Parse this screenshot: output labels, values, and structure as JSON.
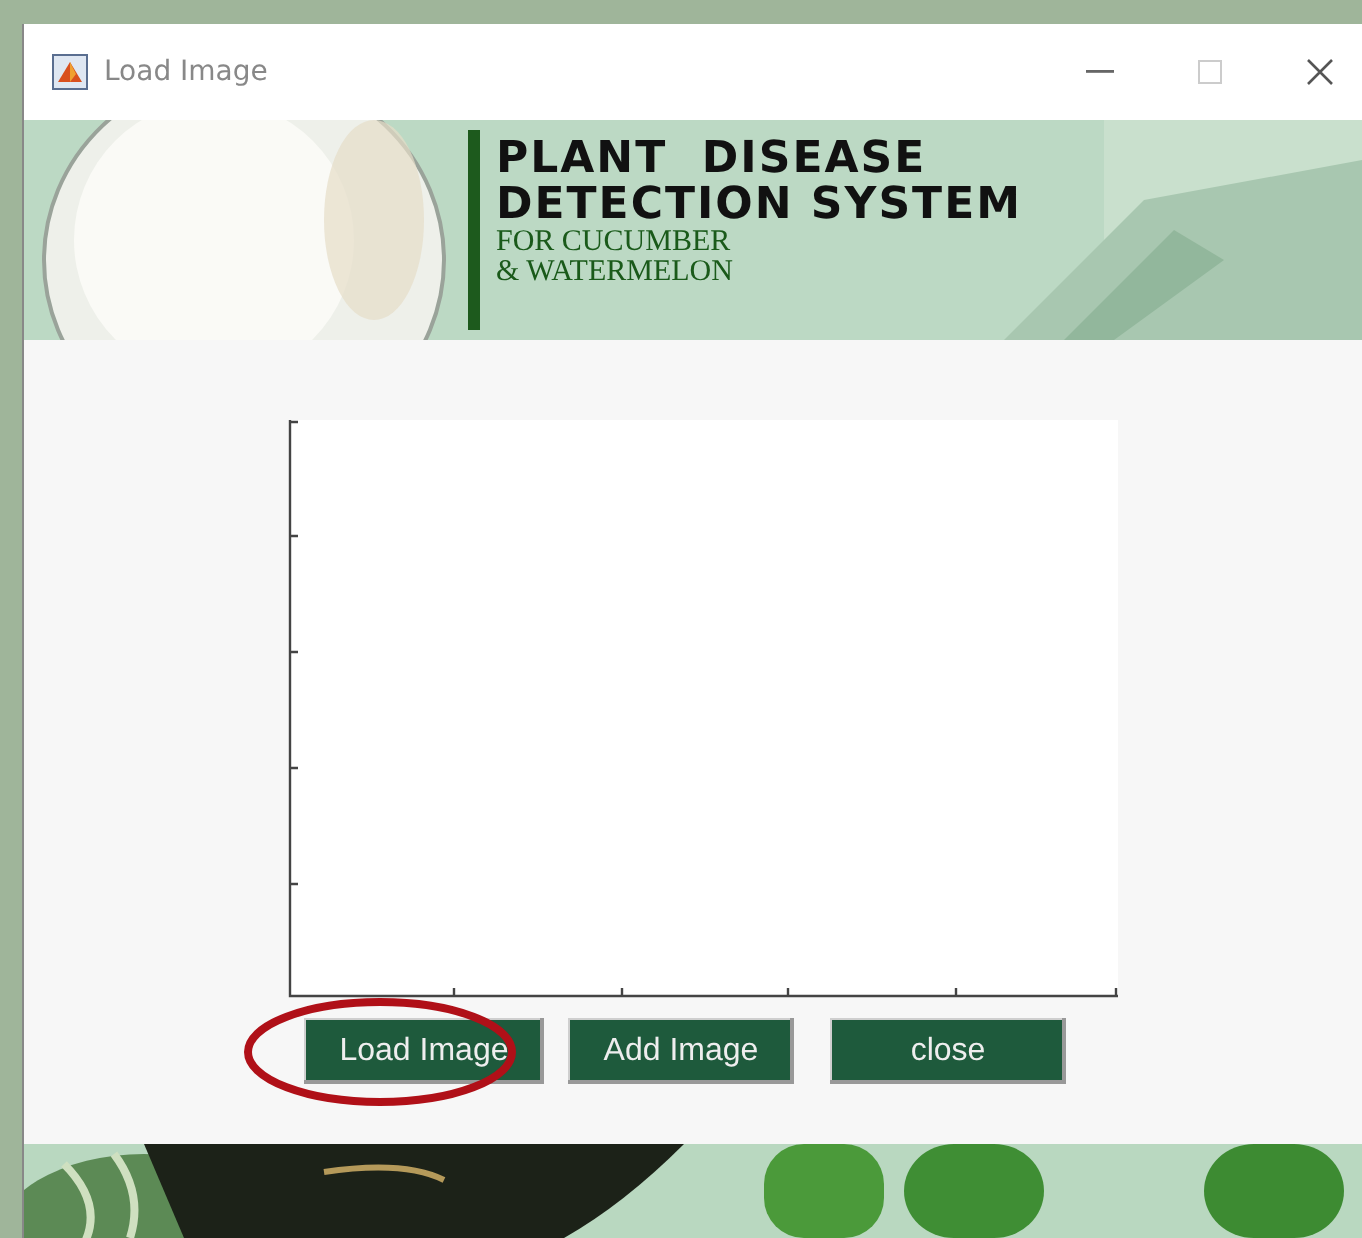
{
  "window": {
    "title": "Load Image"
  },
  "banner": {
    "title_lines": [
      "PLANT  DISEASE",
      "DETECTION SYSTEM"
    ],
    "subtitle_lines": [
      "FOR CUCUMBER",
      "& WATERMELON"
    ]
  },
  "buttons": [
    {
      "label": "Load Image",
      "circled": true
    },
    {
      "label": "Add Image",
      "circled": false
    },
    {
      "label": "close",
      "circled": false
    }
  ]
}
